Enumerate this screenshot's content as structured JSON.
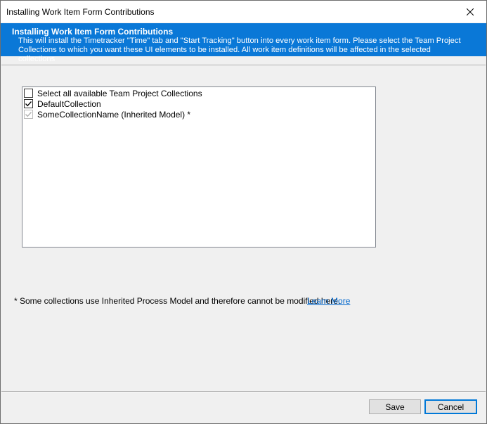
{
  "window": {
    "title": "Installing Work Item Form Contributions"
  },
  "banner": {
    "title": "Installing Work Item Form Contributions",
    "description": "This will install the Timetracker \"Time\" tab and \"Start Tracking\" button into every work item form. Please select the Team Project Collections to which you want these UI elements to be installed. All work item definitions will be affected in the selected collections",
    "background_color": "#0a78d7"
  },
  "collections": {
    "items": [
      {
        "label": "Select all available Team Project Collections",
        "checked": false,
        "enabled": true
      },
      {
        "label": "DefaultCollection",
        "checked": true,
        "enabled": true
      },
      {
        "label": "SomeCollectionName (Inherited Model) *",
        "checked": true,
        "enabled": false
      }
    ]
  },
  "footnote": {
    "text": "* Some collections use Inherited Process Model and therefore cannot be modified here.",
    "link_label": "Learn More",
    "link_color": "#0066cc"
  },
  "buttons": {
    "save_label": "Save",
    "cancel_label": "Cancel"
  },
  "icons": {
    "close": "close-icon",
    "checkmark": "checkmark-icon"
  }
}
